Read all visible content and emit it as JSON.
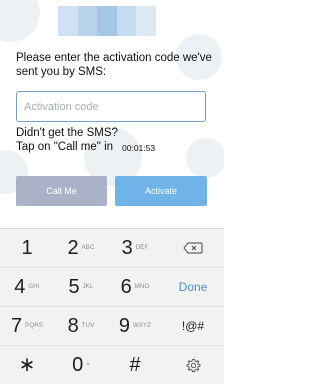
{
  "colors": {
    "accent": "#6fb3e8",
    "call_button": "#a9b2c7",
    "field_border": "#7a9ec8",
    "done_text": "#4a90d9",
    "status_blocks": [
      "#cfe1f2",
      "#b9d3ec",
      "#a6c6e6",
      "#c5dbf0",
      "#dce9f5"
    ]
  },
  "activation": {
    "instruction": "Please enter the activation code we've sent you by SMS:",
    "field_placeholder": "Activation code",
    "field_value": "",
    "sms_question": "Didn't get the SMS?",
    "tap_prompt": "Tap on \"Call me\" in",
    "timer": "00:01:53",
    "call_button": "Call Me",
    "activate_button": "Activate"
  },
  "keyboard": {
    "rows": [
      [
        {
          "name": "key-1",
          "main": "1",
          "sub": ""
        },
        {
          "name": "key-2",
          "main": "2",
          "sub": "ABC"
        },
        {
          "name": "key-3",
          "main": "3",
          "sub": "DEF"
        },
        {
          "name": "key-backspace",
          "icon": "backspace-icon"
        }
      ],
      [
        {
          "name": "key-4",
          "main": "4",
          "sub": "GHI"
        },
        {
          "name": "key-5",
          "main": "5",
          "sub": "JKL"
        },
        {
          "name": "key-6",
          "main": "6",
          "sub": "MNO"
        },
        {
          "name": "key-done",
          "label": "Done"
        }
      ],
      [
        {
          "name": "key-7",
          "main": "7",
          "sub": "PQRS"
        },
        {
          "name": "key-8",
          "main": "8",
          "sub": "TUV"
        },
        {
          "name": "key-9",
          "main": "9",
          "sub": "WXYZ"
        },
        {
          "name": "key-symbols",
          "label": "!@#"
        }
      ],
      [
        {
          "name": "key-star",
          "main": "∗",
          "sub": ""
        },
        {
          "name": "key-0",
          "main": "0",
          "sub": "+"
        },
        {
          "name": "key-hash",
          "main": "#",
          "sub": ""
        },
        {
          "name": "key-settings",
          "icon": "gear-icon"
        }
      ]
    ]
  }
}
